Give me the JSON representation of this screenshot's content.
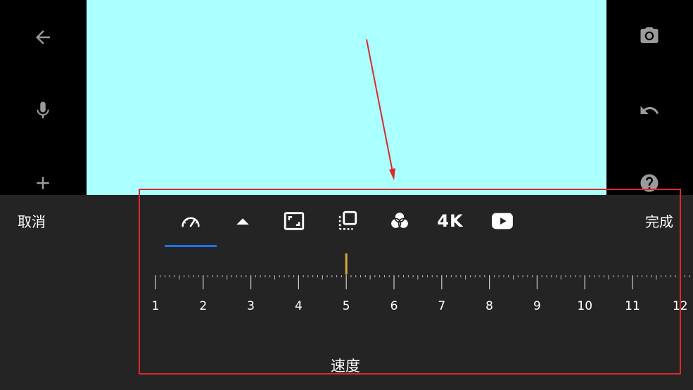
{
  "left_bar": {
    "icons": [
      "back-arrow-icon",
      "microphone-icon",
      "plus-icon"
    ]
  },
  "right_bar": {
    "icons": [
      "camera-icon",
      "undo-icon",
      "help-icon"
    ]
  },
  "bottom_panel": {
    "cancel_label": "取消",
    "done_label": "完成",
    "tools": [
      {
        "name": "speed-icon",
        "active": true
      },
      {
        "name": "caret-up-icon"
      },
      {
        "name": "aspect-ratio-icon"
      },
      {
        "name": "layers-icon"
      },
      {
        "name": "color-filter-icon"
      },
      {
        "name": "resolution-4k-label",
        "text": "4K"
      },
      {
        "name": "youtube-play-icon"
      }
    ],
    "ruler": {
      "ticks": [
        "1",
        "2",
        "3",
        "4",
        "5",
        "6",
        "7",
        "8",
        "9",
        "10",
        "11",
        "12"
      ],
      "current_value": 5
    },
    "speed_label": "速度"
  },
  "colors": {
    "preview_background": "#aaffff",
    "panel_background": "#242424",
    "active_tab_underline": "#1a73e8",
    "ruler_marker": "#d9a83a",
    "annotation_red": "#e0282b"
  }
}
